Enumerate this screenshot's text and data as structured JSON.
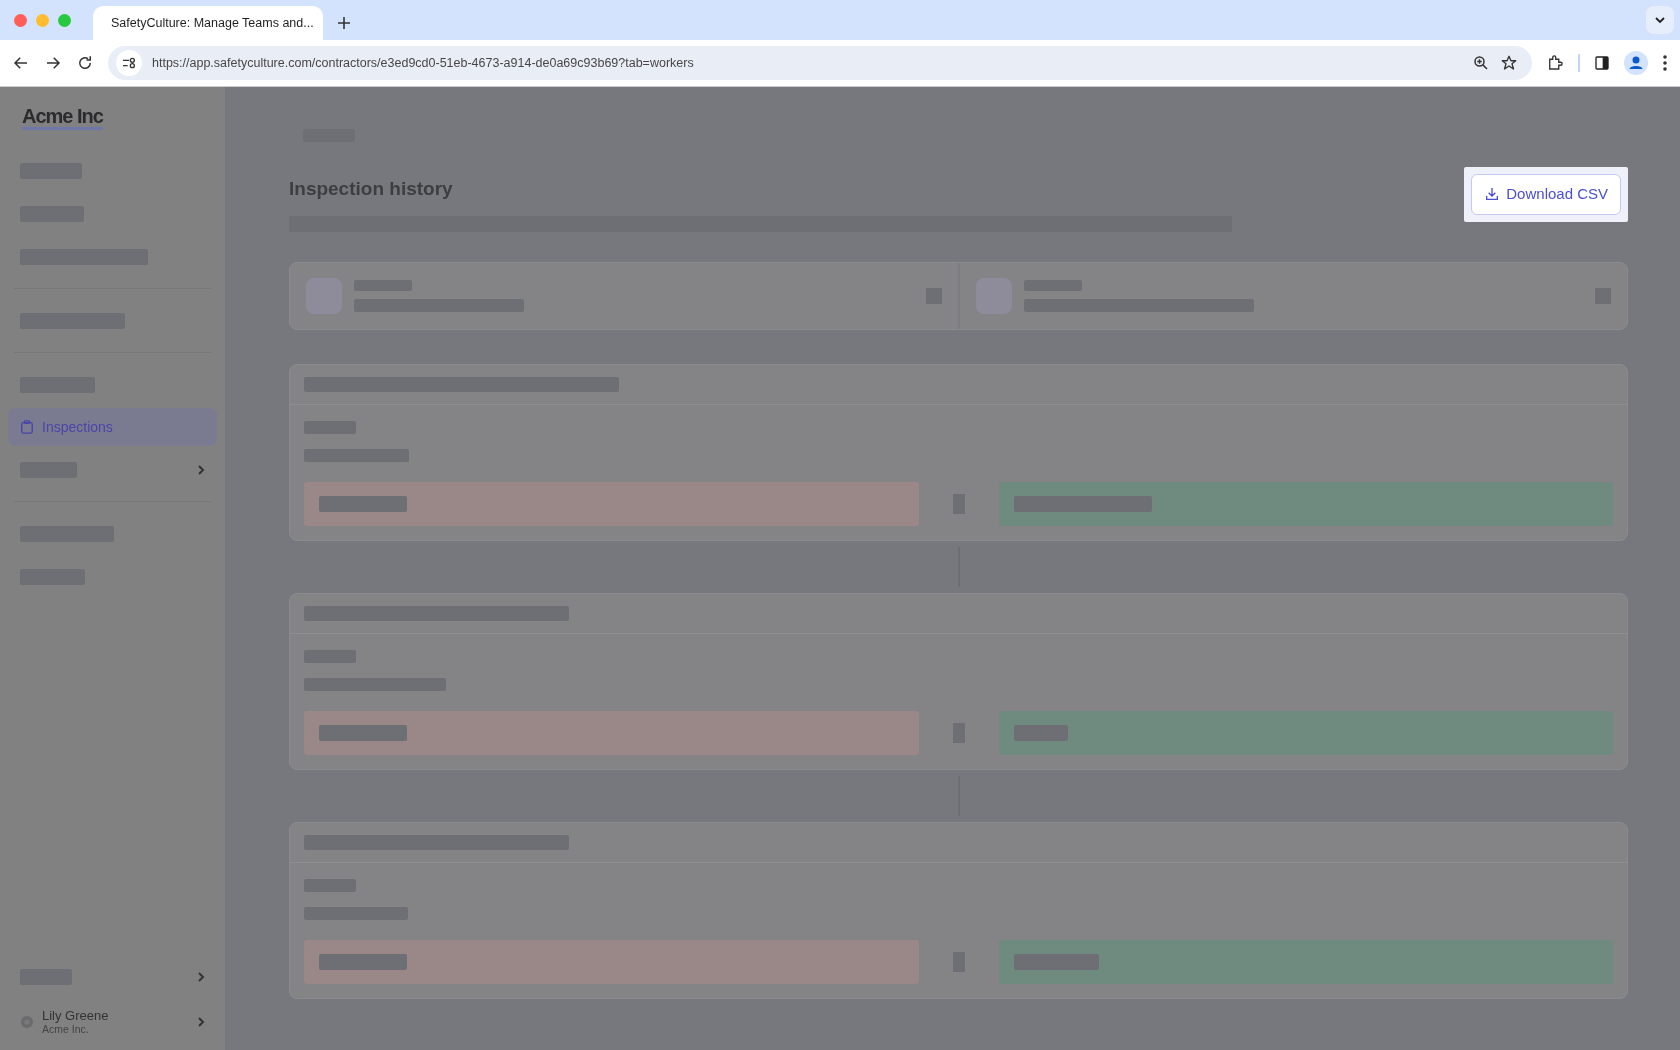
{
  "browser": {
    "tab_title": "SafetyCulture: Manage Teams and...",
    "url": "https://app.safetyculture.com/contractors/e3ed9cd0-51eb-4673-a914-de0a69c93b69?tab=workers"
  },
  "sidebar": {
    "logo": "Acme Inc",
    "items": [
      {
        "label": "Inspections",
        "selected": true
      }
    ],
    "user": {
      "name": "Lily Greene",
      "org": "Acme Inc."
    }
  },
  "main": {
    "title": "Inspection history",
    "download_button": "Download CSV"
  }
}
